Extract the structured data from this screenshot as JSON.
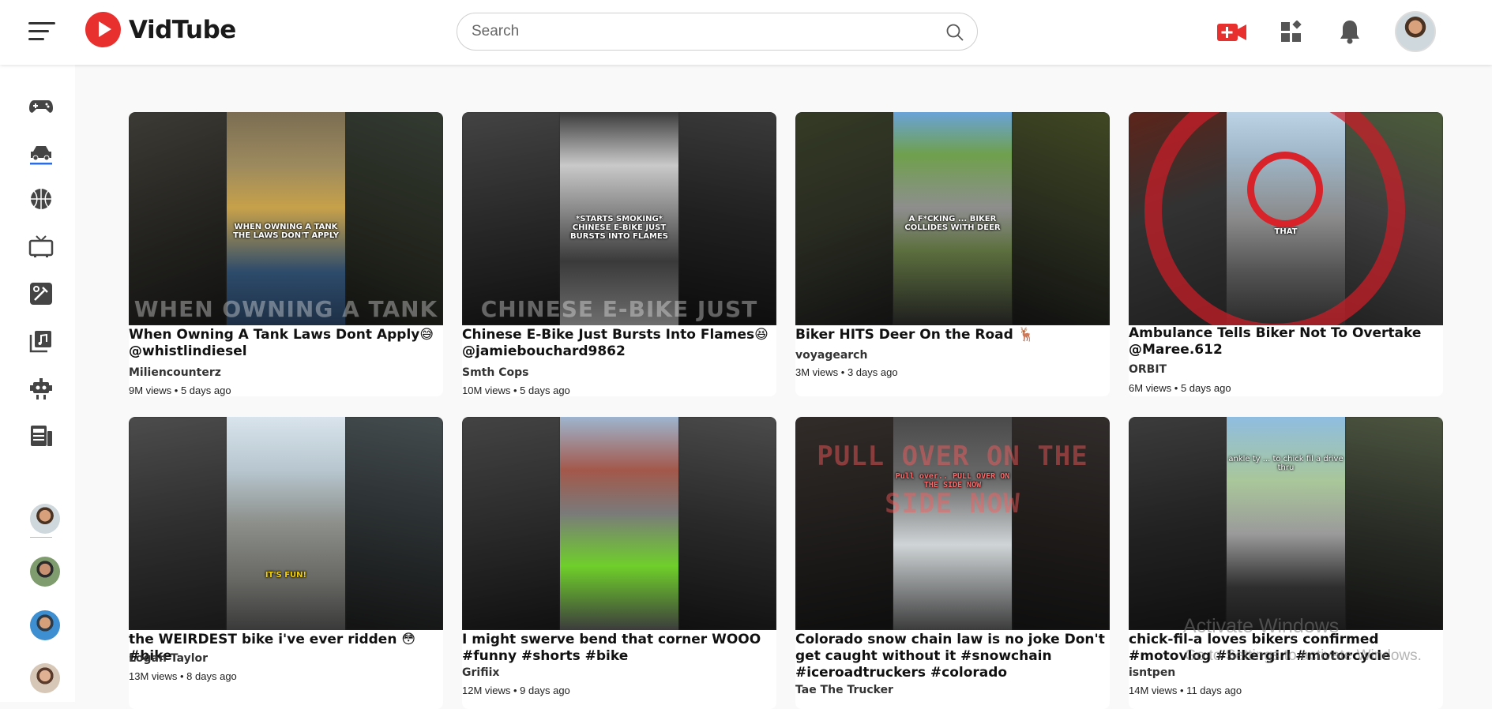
{
  "app": {
    "name": "VidTube",
    "brand_color": "#e8312f"
  },
  "search": {
    "placeholder": "Search"
  },
  "header_icons": [
    "menu-icon",
    "create-video-icon",
    "apps-icon",
    "notifications-icon",
    "avatar"
  ],
  "sidebar": {
    "icons": [
      "gaming-icon",
      "cars-icon",
      "sports-icon",
      "tv-icon",
      "tools-icon",
      "music-icon",
      "robot-icon",
      "news-icon"
    ],
    "active": "cars-icon",
    "subscriptions": [
      "avatar-1",
      "avatar-2",
      "avatar-3",
      "avatar-4"
    ]
  },
  "videos": [
    {
      "title": "When Owning A Tank Laws Dont Apply😅 @whistlindiesel",
      "channel": "Miliencounterz",
      "meta": "9M views • 5 days ago",
      "overlay": "WHEN OWNING A TANK THE LAWS DON'T APPLY",
      "bigtext": "WHEN OWNING A TANK"
    },
    {
      "title": "Chinese E-Bike Just Bursts Into Flames😆 @jamiebouchard9862",
      "channel": "Smth Cops",
      "meta": "10M views • 5 days ago",
      "overlay": "*STARTS SMOKING* CHINESE E-BIKE JUST BURSTS INTO FLAMES",
      "bigtext": "CHINESE E-BIKE JUST"
    },
    {
      "title": "Biker HITS Deer On the Road 🦌",
      "channel": "voyagearch",
      "meta": "3M views • 3 days ago",
      "overlay": "A F*CKING ... BIKER COLLIDES WITH DEER",
      "bigtext": ""
    },
    {
      "title": "Ambulance Tells Biker Not To Overtake @Maree.612",
      "channel": "ORBIT",
      "meta": "6M views • 5 days ago",
      "overlay": "THAT",
      "bigtext": ""
    },
    {
      "title": "the WEIRDEST bike i've ever ridden 😳 #bike",
      "channel": "Logan Taylor",
      "meta": "13M views • 8 days ago",
      "overlay": "IT'S FUN!",
      "bigtext": ""
    },
    {
      "title": "I might swerve bend that corner WOOO #funny #shorts #bike",
      "channel": "Grifiix",
      "meta": "12M views • 9 days ago",
      "overlay": "",
      "bigtext": ""
    },
    {
      "title": "Colorado snow chain law is no joke Don't get caught without it #snowchain #iceroadtruckers #colorado",
      "channel": "Tae The Trucker",
      "meta": "",
      "overlay": "Pull over.. PULL OVER ON THE SIDE NOW",
      "bigtext": "PULL OVER ON THE SIDE NOW"
    },
    {
      "title": "chick-fil-a loves bikers confirmed #motovlog #bikergirl #motorcycle",
      "channel": "isntpen",
      "meta": "14M views • 11 days ago",
      "overlay": "ankle ty ... to chick fil a drive thru",
      "bigtext": ""
    }
  ],
  "watermark": {
    "line1": "Activate Windows",
    "line2": "Go to Settings to activate Windows."
  }
}
